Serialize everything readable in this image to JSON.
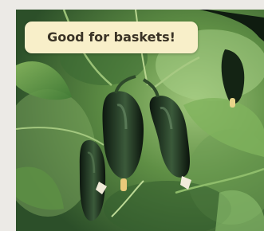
{
  "caption": {
    "text": "Good for baskets!",
    "background_color": "#f8efc9",
    "text_color": "#3a3326"
  },
  "photo": {
    "subject": "cucumbers"
  },
  "page": {
    "background_color": "#eceae6"
  }
}
